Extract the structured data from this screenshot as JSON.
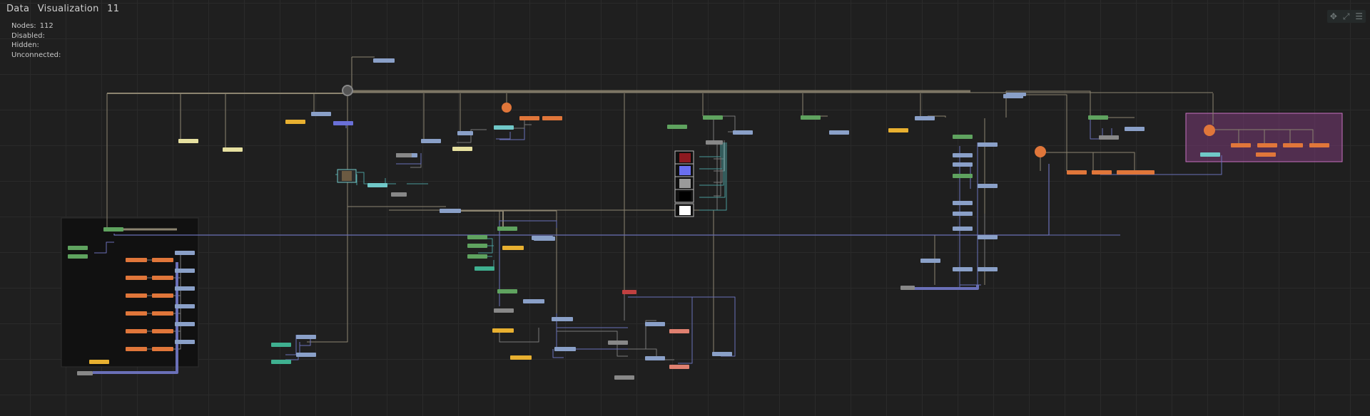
{
  "title": {
    "word1": "Data",
    "word2": "Visualization",
    "word3": "11"
  },
  "stats": [
    {
      "label": "Nodes:",
      "value": "112"
    },
    {
      "label": "Disabled:",
      "value": ""
    },
    {
      "label": "Hidden:",
      "value": ""
    },
    {
      "label": "Unconnected:",
      "value": ""
    }
  ],
  "toolbar_icons": [
    "move-icon",
    "fit-view-icon",
    "menu-icon"
  ],
  "colors": {
    "background": "#1f1f1f",
    "grid": "#2a2a2a",
    "wire_tan": "#8c8470",
    "wire_gray": "#7a7a7a",
    "wire_blue": "#6a70b8",
    "wire_teal": "#4a9a9a",
    "node_blue": "#8aa0c8",
    "node_green": "#5fa35f",
    "node_orange": "#e0763a",
    "node_yellow": "#e8b030",
    "node_cream": "#e6e0a0",
    "node_cyan": "#70c8c8",
    "node_gray": "#888888",
    "node_salmon": "#e08070",
    "node_red": "#c04040",
    "frame_pink": "#c870c0",
    "frame_dark": "#111111"
  }
}
